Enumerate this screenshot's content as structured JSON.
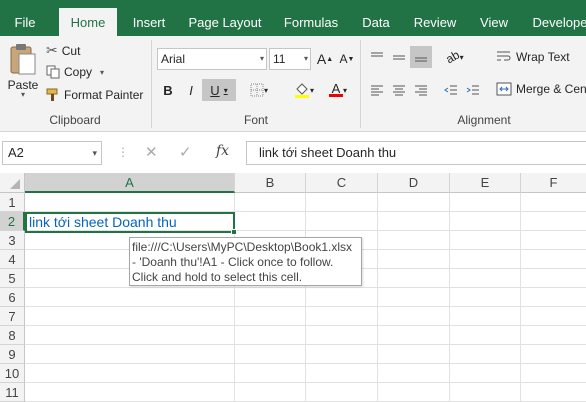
{
  "ribbon_tabs": [
    "File",
    "Home",
    "Insert",
    "Page Layout",
    "Formulas",
    "Data",
    "Review",
    "View",
    "Develope"
  ],
  "clipboard": {
    "paste_label": "Paste",
    "cut_label": "Cut",
    "copy_label": "Copy",
    "format_painter_label": "Format Painter",
    "group_label": "Clipboard"
  },
  "font": {
    "font_name": "Arial",
    "font_size": "11",
    "bold": "B",
    "italic": "I",
    "underline": "U",
    "group_label": "Font"
  },
  "alignment": {
    "wrap_text_label": "Wrap Text",
    "merge_label": "Merge & Cen",
    "group_label": "Alignment"
  },
  "formula_bar": {
    "name_box": "A2",
    "fx_label": "fx",
    "formula": "link tới sheet Doanh thu"
  },
  "sheet": {
    "columns": [
      "A",
      "B",
      "C",
      "D",
      "E",
      "F"
    ],
    "rows": [
      "1",
      "2",
      "3",
      "4",
      "5",
      "6",
      "7",
      "8",
      "9",
      "10",
      "11"
    ],
    "cell_a2": "link tới sheet Doanh thu"
  },
  "tooltip": {
    "line1": "file:///C:\\Users\\MyPC\\Desktop\\Book1.xlsx",
    "line2": "- 'Doanh thu'!A1 - Click once to follow.",
    "line3": "Click and hold to select this cell."
  },
  "colors": {
    "accent": "#217346",
    "hyperlink": "#0563c1",
    "ribbon_bg": "#f3f3f3"
  }
}
